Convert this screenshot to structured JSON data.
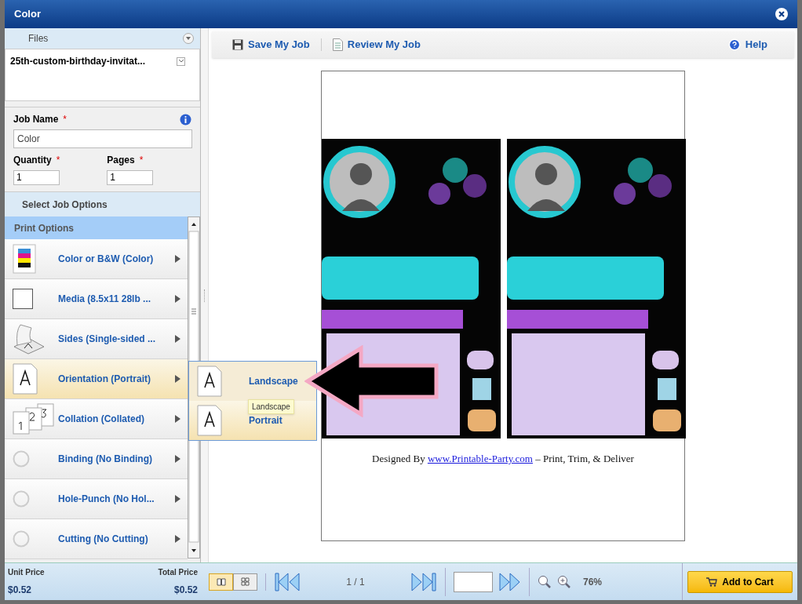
{
  "window": {
    "title": "Color"
  },
  "files": {
    "title": "Files",
    "items": [
      {
        "name": "25th-custom-birthday-invitat..."
      }
    ]
  },
  "job_fields": [
    {
      "label": "Job Name",
      "mark": "*",
      "value": "Color",
      "kind": "wide"
    },
    {
      "label": "Quantity",
      "mark": "*",
      "value": "1",
      "kind": "narrow"
    },
    {
      "label": "Pages",
      "mark": "*",
      "value": "1",
      "kind": "narrow"
    }
  ],
  "job_options": {
    "title": "Select Job Options",
    "group": "Print Options",
    "items": [
      {
        "label": "Color or B&W (Color)",
        "kind": "cmyk",
        "selected": false
      },
      {
        "label": "Media (8.5x11 28lb ...",
        "kind": "media",
        "selected": false
      },
      {
        "label": "Sides (Single-sided ...",
        "kind": "sides",
        "selected": false
      },
      {
        "label": "Orientation (Portrait)",
        "kind": "page",
        "selected": true
      },
      {
        "label": "Collation (Collated)",
        "kind": "collate",
        "selected": false
      },
      {
        "label": "Binding (No Binding)",
        "kind": "none",
        "selected": false
      },
      {
        "label": "Hole-Punch (No Hol...",
        "kind": "none",
        "selected": false
      },
      {
        "label": "Cutting (No Cutting)",
        "kind": "none",
        "selected": false
      }
    ]
  },
  "submenu": {
    "items": [
      {
        "label": "Landscape",
        "selected": true
      },
      {
        "label": "Portrait",
        "selected": false
      }
    ],
    "tooltip": "Landscape"
  },
  "toolbar": {
    "items": [
      {
        "label": "Save My Job",
        "kind": "save"
      },
      {
        "label": "Review My Job",
        "kind": "review"
      }
    ],
    "help": "Help"
  },
  "preview": {
    "credit": {
      "before": "Designed By ",
      "link": "www.Printable-Party.com",
      "after": " – Print, Trim, & Deliver"
    }
  },
  "footer": {
    "unit_price_label": "Unit Price",
    "unit_price": "$0.52",
    "total_price_label": "Total Price",
    "total_price": "$0.52",
    "views": [
      {
        "kind": "book",
        "selected": true
      },
      {
        "kind": "grid",
        "selected": false
      }
    ],
    "page": "1 / 1",
    "zoom": "76%",
    "cart": "Add to Cart"
  }
}
